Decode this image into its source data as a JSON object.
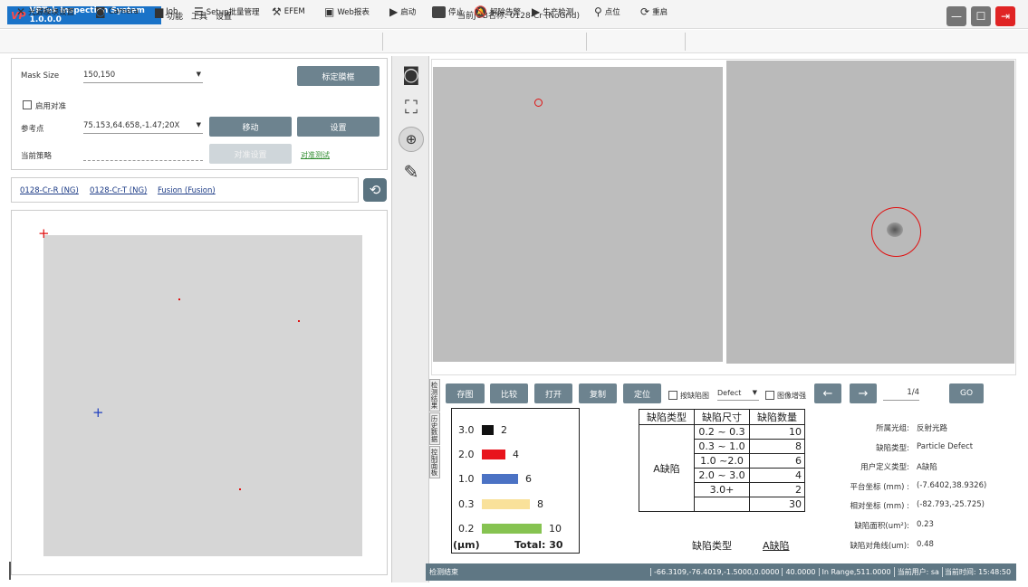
{
  "app": {
    "logo": "VP",
    "title": "VPTek Inspection System 1.0.0.0",
    "job_title": "当前JOB名称: 0128-Cr (NoGrid)"
  },
  "menu": [
    "功能",
    "工具",
    "设置"
  ],
  "window_controls": {
    "minimize": "—",
    "maximize": "☐",
    "exit": "⇥"
  },
  "toolbar": [
    {
      "icon": "light-source-icon",
      "glyph": "✕",
      "label": "光源模块设置"
    },
    {
      "icon": "camera-icon",
      "glyph": "◙",
      "label": "Camera"
    },
    {
      "icon": "briefcase-icon",
      "glyph": "▆",
      "label": "Job"
    },
    {
      "icon": "list-icon",
      "glyph": "☰",
      "label": "Setup批量管理"
    },
    {
      "icon": "robot-arm-icon",
      "glyph": "⚒",
      "label": "EFEM"
    },
    {
      "icon": "web-icon",
      "glyph": "▣",
      "label": "Web报表"
    },
    {
      "icon": "play-icon",
      "glyph": "▶",
      "label": "启动"
    },
    {
      "icon": "stop-icon",
      "glyph": "■",
      "label": "停止"
    },
    {
      "icon": "alarm-off-icon",
      "glyph": "🔕",
      "label": "解除告警"
    },
    {
      "icon": "play-icon",
      "glyph": "▶",
      "label": "生产检测"
    },
    {
      "icon": "locate-icon",
      "glyph": "⚲",
      "label": "点位"
    },
    {
      "icon": "restart-icon",
      "glyph": "⟳",
      "label": "重启"
    }
  ],
  "settings": {
    "mask_size_label": "Mask Size",
    "mask_size_value": "150,150",
    "calibrate_btn": "标定膜框",
    "enable_align_label": "启用对准",
    "ref_point_label": "参考点",
    "ref_point_value": "75.153,64.658,-1.47;20X",
    "move_btn": "移动",
    "set_btn": "设置",
    "strategy_label": "当前策略",
    "strategy_value": "",
    "align_settings_btn": "对准设置",
    "align_test_link": "对准测试"
  },
  "job_links": [
    "0128-Cr-R (NG)",
    "0128-Cr-T (NG)",
    "Fusion (Fusion)"
  ],
  "side_tabs": [
    "控制面板",
    "历史数据",
    "检测结果"
  ],
  "actions": {
    "save_image": "存图",
    "compare": "比较",
    "open": "打开",
    "copy": "复制",
    "locate": "定位"
  },
  "filters": {
    "by_defect_label": "按缺陷图",
    "defect_select": "Defect",
    "enhance_label": "图像增强"
  },
  "nav": {
    "prev": "←",
    "next": "→",
    "page": "1/4",
    "go": "GO"
  },
  "legend": {
    "rows": [
      {
        "size": "3.0",
        "count": "2",
        "color": "#111111",
        "frac": 0.2
      },
      {
        "size": "2.0",
        "count": "4",
        "color": "#e8141c",
        "frac": 0.4
      },
      {
        "size": "1.0",
        "count": "6",
        "color": "#4b72c4",
        "frac": 0.6
      },
      {
        "size": "0.3",
        "count": "8",
        "color": "#f9e19a",
        "frac": 0.8
      },
      {
        "size": "0.2",
        "count": "10",
        "color": "#86c351",
        "frac": 1.0
      }
    ],
    "unit": "(μm)",
    "total": "Total: 30"
  },
  "defect_table": {
    "headers": [
      "缺陷类型",
      "缺陷尺寸",
      "缺陷数量"
    ],
    "type": "A缺陷",
    "rows": [
      [
        "0.2 ~ 0.3",
        "10"
      ],
      [
        "0.3 ~ 1.0",
        "8"
      ],
      [
        "1.0 ~2.0",
        "6"
      ],
      [
        "2.0 ~ 3.0",
        "4"
      ],
      [
        "3.0+",
        "2"
      ],
      [
        "",
        "30"
      ]
    ]
  },
  "defect_type_caption": {
    "label": "缺陷类型",
    "value": "A缺陷"
  },
  "info": [
    {
      "k": "所属光组:",
      "v": "反射光路"
    },
    {
      "k": "缺陷类型:",
      "v": "Particle Defect"
    },
    {
      "k": "用户定义类型:",
      "v": "A缺陷"
    },
    {
      "k": "平台坐标 (mm) :",
      "v": "(-7.6402,38.9326)"
    },
    {
      "k": "相对坐标 (mm) :",
      "v": "(-82.793,-25.725)"
    },
    {
      "k": "缺陷面积(um²):",
      "v": "0.23"
    },
    {
      "k": "缺陷对角线(um):",
      "v": "0.48"
    }
  ],
  "status": {
    "left": "检测结束",
    "coords": "-66.3109,-76.4019,-1.5000,0.0000",
    "zoom": "40.0000",
    "range": "In Range,511.0000",
    "user": "当前用户: sa",
    "time": "当前时间: 15:48:50"
  }
}
